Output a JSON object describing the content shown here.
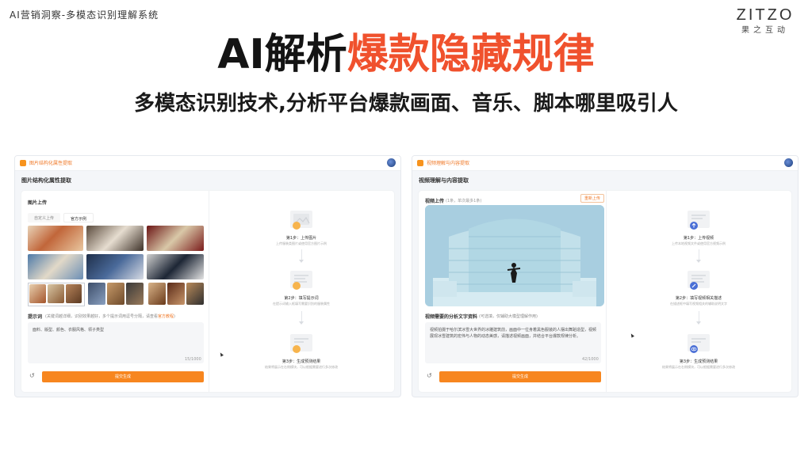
{
  "header": {
    "top_label": "AI营销洞察-多模态识别理解系统",
    "title_dark": "AI解析",
    "title_accent": "爆款隐藏规律",
    "subtitle": "多模态识别技术,分析平台爆款画面、音乐、脚本哪里吸引人"
  },
  "logo": {
    "main": "ZITZO",
    "sub": "果之互动"
  },
  "colors": {
    "accent": "#f0512d",
    "brand_orange": "#f7861f",
    "panel_bg": "#f4f6f9"
  },
  "left_panel": {
    "topbar_brand": "图片结构化属性提取",
    "crumb": "图片结构化属性提取",
    "upload_title": "图片上传",
    "tabs": [
      "自定义上传",
      "官方示例"
    ],
    "prompt_label": "提示词",
    "prompt_help": "(关键词越详细，识别效果越好，多个提示词用逗号分隔，请查看",
    "prompt_help_link": "官方教程",
    "prompt_help_end": ")",
    "prompt_value": "面料、版型、颜色、衣服风格、领子类型",
    "counter": "15/1000",
    "submit_label": "提交生成",
    "steps": [
      {
        "title": "第1步：上传图片",
        "desc": "上传服装类图片或使用官方图片示例",
        "icon": "image-upload-icon"
      },
      {
        "title": "第2步：填写提示词",
        "desc": "在提示词输入框填写需要识别的服装属性",
        "icon": "document-icon"
      },
      {
        "title": "第3步：生成预测结果",
        "desc": "结果将展示在右侧模块，可以根据需要进行多次修改",
        "icon": "result-icon"
      }
    ]
  },
  "right_panel": {
    "topbar_brand": "视频理解与内容提取",
    "crumb": "视频理解与内容提取",
    "upload_title": "视频上传",
    "upload_hint": "(1条，单次最多1条)",
    "tag_button": "重新上传",
    "prompt_label": "视频需要的分析文字资料",
    "prompt_hint": "(可选填，仅辅助大模型理解作用)",
    "prompt_value": "视频拍摄于哈尔滨冰雪大世界的冰雕建筑前，画面中一位身着黑色服装的人摆出舞蹈造型，视频展现冰雪建筑的宏伟与人物的动态美感，请描述视频画面，并结合平台爆款规律分析。",
    "counter": "42/1000",
    "submit_label": "提交生成",
    "steps": [
      {
        "title": "第1步：上传视频",
        "desc": "上传本地视频文件或使用官方视频示例",
        "icon": "upload-icon"
      },
      {
        "title": "第2步：填写视频相关描述",
        "desc": "在描述框中填写视频相关的辅助说明文字",
        "icon": "edit-icon"
      },
      {
        "title": "第3步：生成预测结果",
        "desc": "结果将展示在右侧模块，可以根据需要进行多次修改",
        "icon": "eye-icon"
      }
    ]
  }
}
